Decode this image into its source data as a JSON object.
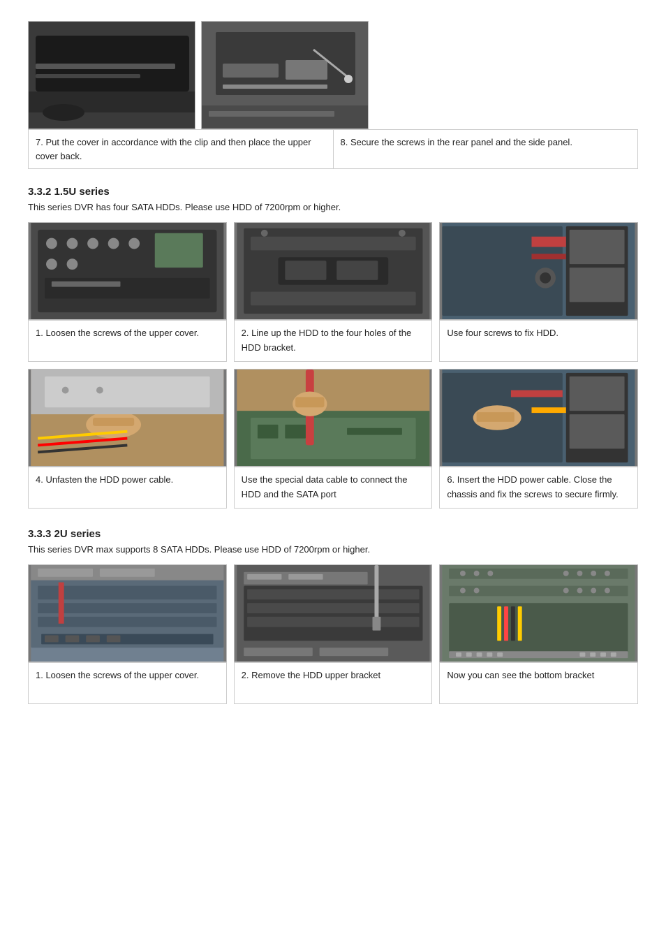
{
  "top_section": {
    "images": [
      {
        "id": "top-img-1",
        "bg": "#3a3a3a",
        "alt": "DVR cover being placed"
      },
      {
        "id": "top-img-2",
        "bg": "#5a5a5a",
        "alt": "Screwing rear and side panel"
      }
    ],
    "captions": [
      {
        "text": "7. Put the cover in accordance with the clip and then place the upper cover back."
      },
      {
        "text": "8.  Secure the screws in the rear panel and the side panel."
      }
    ]
  },
  "section_332": {
    "heading": "3.3.2  1.5U series",
    "description": "This series DVR has four SATA HDDs. Please use HDD of 7200rpm or higher.",
    "rows": [
      {
        "cells": [
          {
            "img_bg": "#4a4a4a",
            "caption": "1. Loosen the screws of the upper cover."
          },
          {
            "img_bg": "#555555",
            "caption": "2. Line up the HDD to the four holes of the HDD bracket."
          },
          {
            "img_bg": "#4a6070",
            "caption": "Use four screws to fix HDD."
          }
        ]
      },
      {
        "cells": [
          {
            "img_bg": "#c0a070",
            "caption": "4. Unfasten the HDD power cable."
          },
          {
            "img_bg": "#b09060",
            "caption": "Use the special data cable to connect the HDD and the SATA port"
          },
          {
            "img_bg": "#4a6070",
            "caption": "6. Insert the HDD power cable. Close the chassis and fix the screws to secure firmly."
          }
        ]
      }
    ]
  },
  "section_333": {
    "heading": "3.3.3  2U series",
    "description": "This series DVR max supports 8 SATA HDDs. Please use HDD of 7200rpm or higher.",
    "rows": [
      {
        "cells": [
          {
            "img_bg": "#708090",
            "caption": "1. Loosen the screws of the upper cover."
          },
          {
            "img_bg": "#606060",
            "caption": "2.  Remove the HDD upper bracket"
          },
          {
            "img_bg": "#7a8a7a",
            "caption": "Now you can see the bottom bracket"
          }
        ]
      }
    ]
  }
}
